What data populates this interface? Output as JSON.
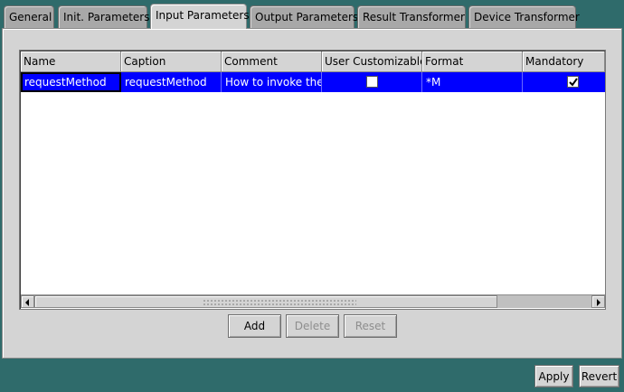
{
  "tabs": [
    {
      "label": "General"
    },
    {
      "label": "Init. Parameters"
    },
    {
      "label": "Input Parameters",
      "active": true
    },
    {
      "label": "Output Parameters"
    },
    {
      "label": "Result Transformer"
    },
    {
      "label": "Device Transformer"
    }
  ],
  "table": {
    "columns": [
      "Name",
      "Caption",
      "Comment",
      "User Customizable",
      "Format",
      "Mandatory"
    ],
    "rows": [
      {
        "name": "requestMethod",
        "caption": "requestMethod",
        "comment": "How to invoke the...",
        "user_customizable": false,
        "format": "*M",
        "mandatory": true
      }
    ]
  },
  "table_buttons": {
    "add": "Add",
    "delete": "Delete",
    "reset": "Reset"
  },
  "footer_buttons": {
    "apply": "Apply",
    "revert": "Revert"
  },
  "colors": {
    "background": "#2f6b6b",
    "panel": "#d4d4d4",
    "selection": "#0000ff"
  }
}
